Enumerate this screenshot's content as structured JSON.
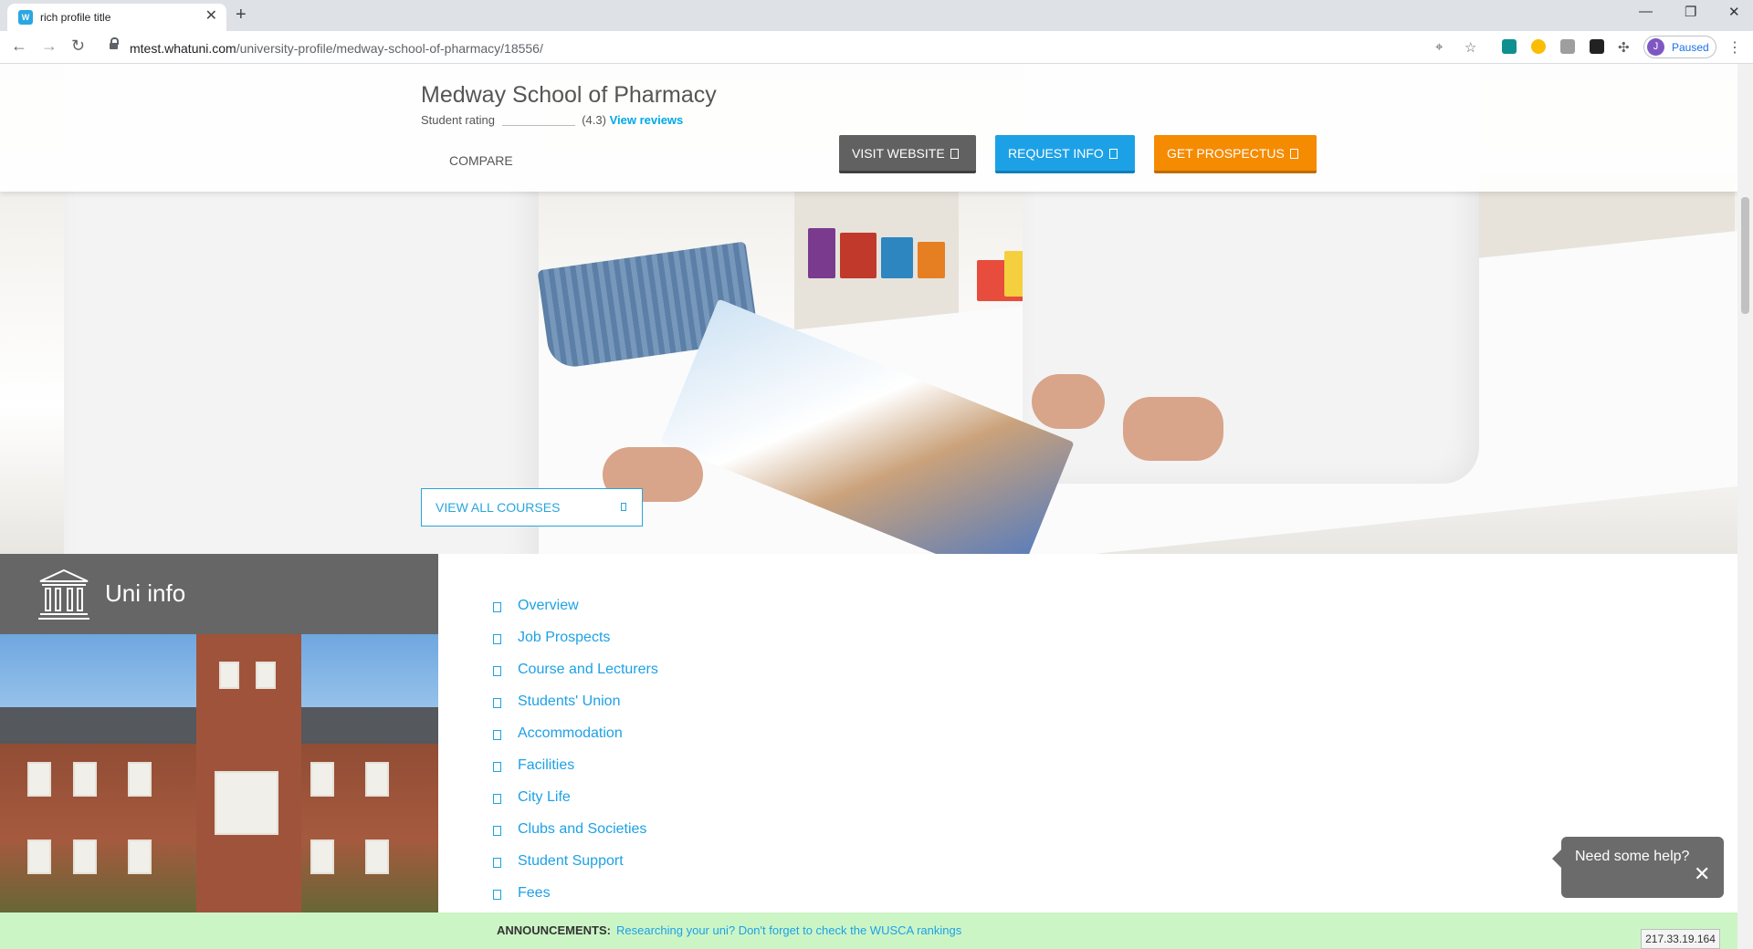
{
  "browser": {
    "tab_title": "rich profile title",
    "favicon_label": "W",
    "tab_close": "✕",
    "new_tab": "+",
    "url_domain": "mtest.whatuni.com",
    "url_path": "/university-profile/medway-school-of-pharmacy/18556/",
    "profile_initial": "J",
    "profile_status": "Paused",
    "window_controls": [
      "—",
      "❐",
      "✕"
    ]
  },
  "header": {
    "uni_name": "Medway School of Pharmacy",
    "rating_label": "Student rating",
    "rating_value": "(4.3)",
    "view_reviews": "View reviews",
    "compare": "COMPARE",
    "visit_website": "VISIT WEBSITE",
    "request_info": "REQUEST INFO",
    "get_prospectus": "GET PROSPECTUS"
  },
  "hero": {
    "view_all_courses": "VIEW ALL COURSES"
  },
  "uni_info": {
    "title": "Uni info",
    "links": [
      "Overview",
      "Job Prospects",
      "Course and Lecturers",
      "Students' Union",
      "Accommodation",
      "Facilities",
      "City Life",
      "Clubs and Societies",
      "Student Support",
      "Fees"
    ]
  },
  "help": {
    "text": "Need some help?",
    "close": "✕"
  },
  "announcements": {
    "label": "ANNOUNCEMENTS:",
    "text": "Researching your uni? Don't forget to check the WUSCA rankings"
  },
  "ip_address": "217.33.19.164",
  "colors": {
    "brand_blue": "#1da1e6",
    "orange": "#f58b00",
    "grey_button": "#616161",
    "announce_bg": "#ccf5c6"
  }
}
